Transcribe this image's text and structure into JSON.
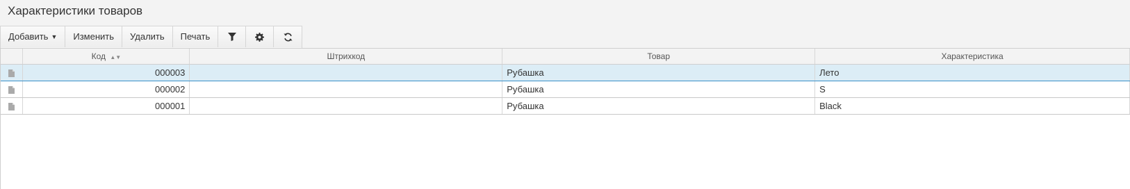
{
  "page": {
    "title": "Характеристики товаров"
  },
  "toolbar": {
    "add_label": "Добавить",
    "edit_label": "Изменить",
    "delete_label": "Удалить",
    "print_label": "Печать",
    "filter_icon": "filter-icon",
    "settings_icon": "gear-icon",
    "refresh_icon": "refresh-icon"
  },
  "table": {
    "columns": {
      "code": "Код",
      "barcode": "Штрихкод",
      "product": "Товар",
      "characteristic": "Характеристика"
    },
    "rows": [
      {
        "code": "000003",
        "barcode": "",
        "product": "Рубашка",
        "characteristic": "Лето",
        "selected": true
      },
      {
        "code": "000002",
        "barcode": "",
        "product": "Рубашка",
        "characteristic": "S",
        "selected": false
      },
      {
        "code": "000001",
        "barcode": "",
        "product": "Рубашка",
        "characteristic": "Black",
        "selected": false
      }
    ]
  },
  "colors": {
    "selection_bg": "#dcedf6",
    "selection_border": "#3a8fc8"
  }
}
